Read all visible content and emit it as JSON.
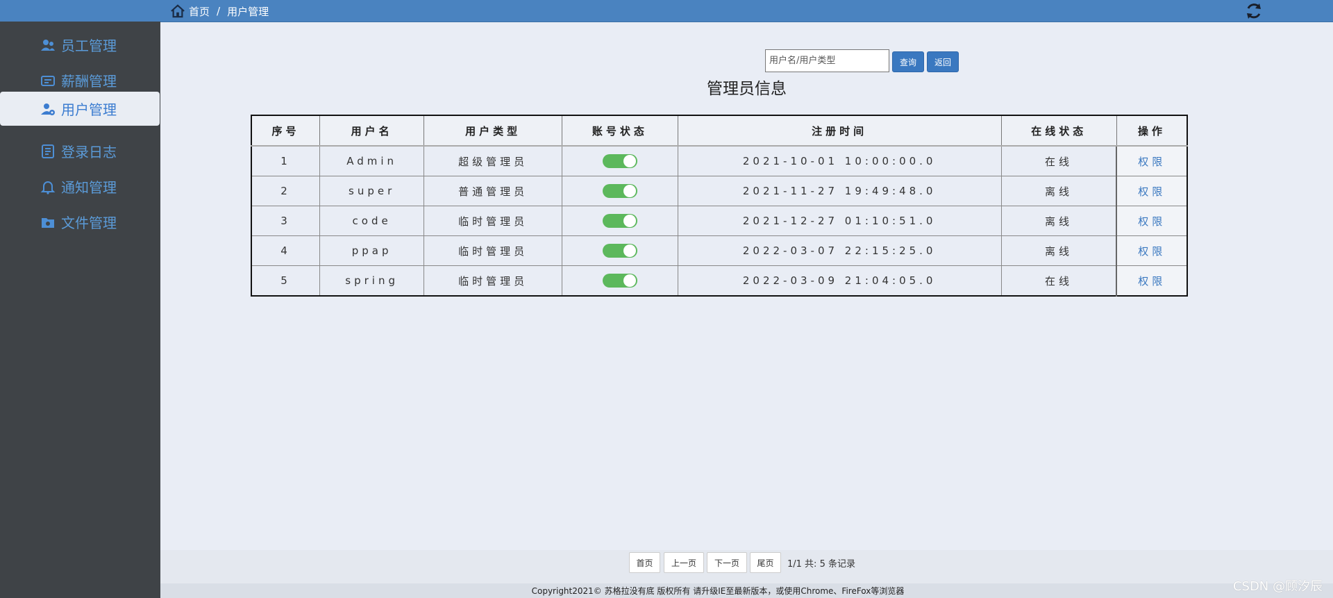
{
  "breadcrumb": {
    "home": "首页",
    "separator": "/",
    "current": "用户管理"
  },
  "sidebar": {
    "items": [
      {
        "label": "员工管理",
        "icon": "user-group-icon"
      },
      {
        "label": "薪酬管理",
        "icon": "salary-icon"
      },
      {
        "label": "用户管理",
        "icon": "user-settings-icon",
        "active": true
      },
      {
        "label": "登录日志",
        "icon": "log-icon"
      },
      {
        "label": "通知管理",
        "icon": "bell-icon"
      },
      {
        "label": "文件管理",
        "icon": "folder-icon"
      }
    ]
  },
  "search": {
    "placeholder": "用户名/用户类型",
    "query_label": "查询",
    "back_label": "返回"
  },
  "title": "管理员信息",
  "table": {
    "headers": [
      "序号",
      "用户名",
      "用户类型",
      "账号状态",
      "注册时间",
      "在线状态",
      "操作"
    ],
    "rows": [
      {
        "no": "1",
        "username": "Admin",
        "type": "超级管理员",
        "enabled": true,
        "registered": "2021-10-01 10:00:00.0",
        "online": "在线",
        "action": "权限"
      },
      {
        "no": "2",
        "username": "super",
        "type": "普通管理员",
        "enabled": true,
        "registered": "2021-11-27 19:49:48.0",
        "online": "离线",
        "action": "权限"
      },
      {
        "no": "3",
        "username": "code",
        "type": "临时管理员",
        "enabled": true,
        "registered": "2021-12-27 01:10:51.0",
        "online": "离线",
        "action": "权限"
      },
      {
        "no": "4",
        "username": "ppap",
        "type": "临时管理员",
        "enabled": true,
        "registered": "2022-03-07 22:15:25.0",
        "online": "离线",
        "action": "权限"
      },
      {
        "no": "5",
        "username": "spring",
        "type": "临时管理员",
        "enabled": true,
        "registered": "2022-03-09 21:04:05.0",
        "online": "在线",
        "action": "权限"
      }
    ]
  },
  "pager": {
    "first": "首页",
    "prev": "上一页",
    "next": "下一页",
    "last": "尾页",
    "info": "1/1 共: 5 条记录"
  },
  "footer": "Copyright2021© 苏格拉没有底 版权所有 请升级IE至最新版本，或使用Chrome、FireFox等浏览器",
  "watermark": "CSDN @顾汐辰",
  "colors": {
    "topbar": "#4a83c0",
    "sidebar": "#3f4347",
    "accent": "#3a78c0",
    "online": "#5cb85c"
  }
}
